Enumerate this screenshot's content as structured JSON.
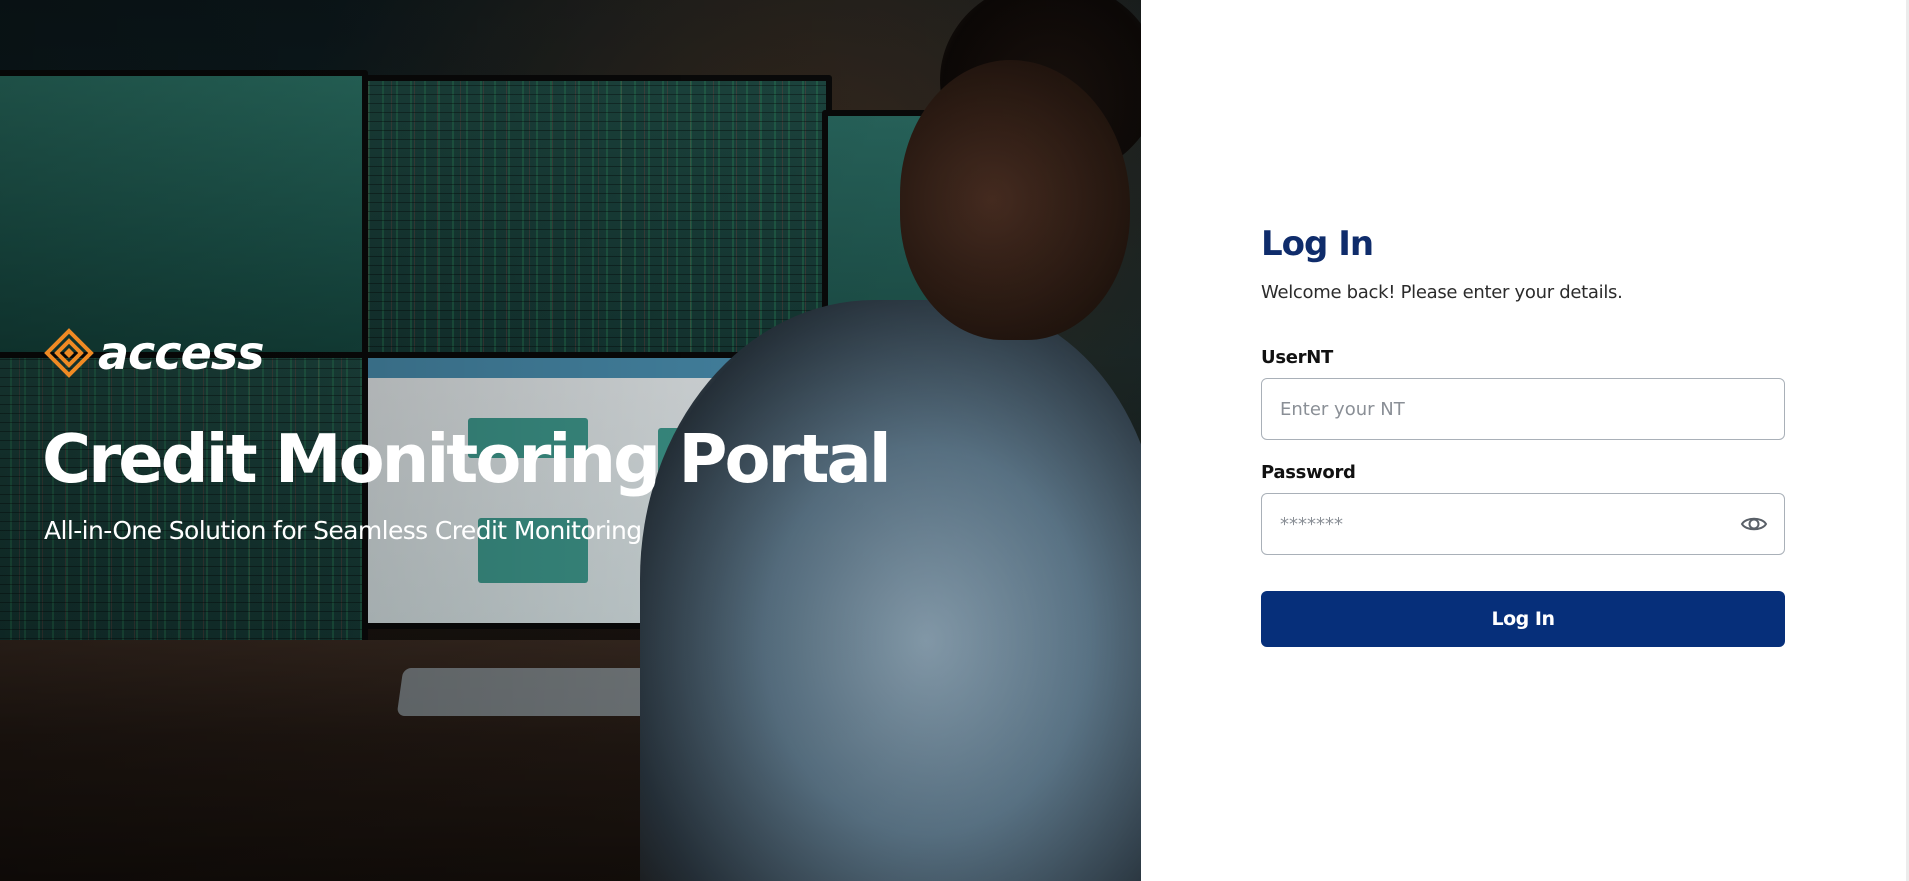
{
  "hero": {
    "brand_name": "access",
    "title": "Credit Monitoring Portal",
    "subtitle": "All-in-One Solution for Seamless Credit Monitoring",
    "brand_icon": "access-diamond-logo"
  },
  "login": {
    "title": "Log In",
    "subtitle": "Welcome back! Please enter your details.",
    "username_label": "UserNT",
    "username_placeholder": "Enter your NT",
    "username_value": "",
    "password_label": "Password",
    "password_placeholder": "*******",
    "password_value": "",
    "password_toggle_icon": "eye-icon",
    "submit_label": "Log In"
  },
  "colors": {
    "primary": "#062f7a",
    "title": "#0f2c6b",
    "brand_orange": "#f08a24",
    "input_border": "#a9b0b8"
  }
}
